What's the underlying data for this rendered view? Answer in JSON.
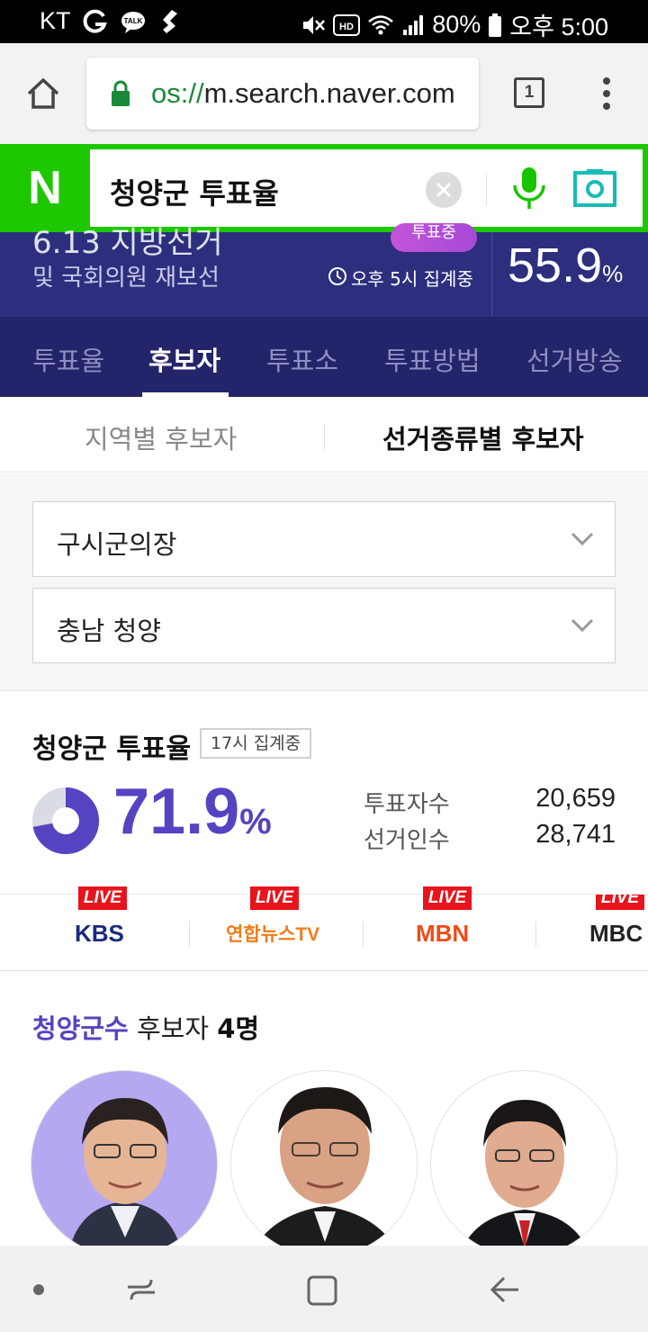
{
  "status_bar": {
    "carrier": "KT",
    "battery_percent": "80%",
    "time": "오후 5:00"
  },
  "browser": {
    "url_prefix": "os://",
    "url_host": "m.search.naver.com",
    "tab_count": "1"
  },
  "search": {
    "logo": "N",
    "query": "청양군 투표율"
  },
  "banner": {
    "title_partial": "6.13 지방선거",
    "subtitle": "및 국회의원 재보선",
    "badge": "투표중",
    "time_note": "오후 5시 집계중",
    "national_rate": "55.9",
    "percent_sign": "%"
  },
  "nav_tabs": [
    "투표율",
    "후보자",
    "투표소",
    "투표방법",
    "선거방송"
  ],
  "sub_tabs": [
    "지역별 후보자",
    "선거종류별 후보자"
  ],
  "selects": [
    "구시군의장",
    "충남 청양"
  ],
  "turnout": {
    "title": "청양군 투표율",
    "badge": "17시 집계중",
    "rate": "71.9",
    "rate_fraction": 0.719,
    "percent_sign": "%",
    "voters_label": "투표자수",
    "voters_value": "20,659",
    "electorate_label": "선거인수",
    "electorate_value": "28,741"
  },
  "broadcasts": {
    "live_label": "LIVE",
    "channels": [
      "KBS",
      "연합뉴스TV",
      "MBN",
      "MBC"
    ]
  },
  "candidates": {
    "heading_region": "청양군수",
    "heading_label": "후보자",
    "heading_count": "4명"
  },
  "colors": {
    "naver_green": "#1ec800",
    "banner_purple": "#2d2f7e",
    "tab_bg": "#24246a",
    "accent_purple": "#5444c2",
    "live_red": "#e8141c"
  }
}
